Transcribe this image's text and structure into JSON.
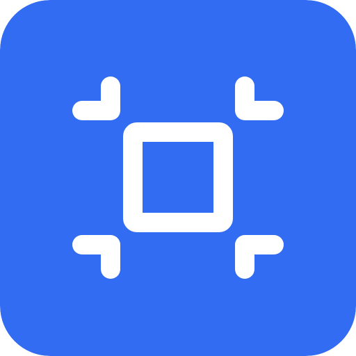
{
  "icon": {
    "name": "select-region-icon",
    "background_color": "#316cf2",
    "foreground_color": "#ffffff"
  }
}
